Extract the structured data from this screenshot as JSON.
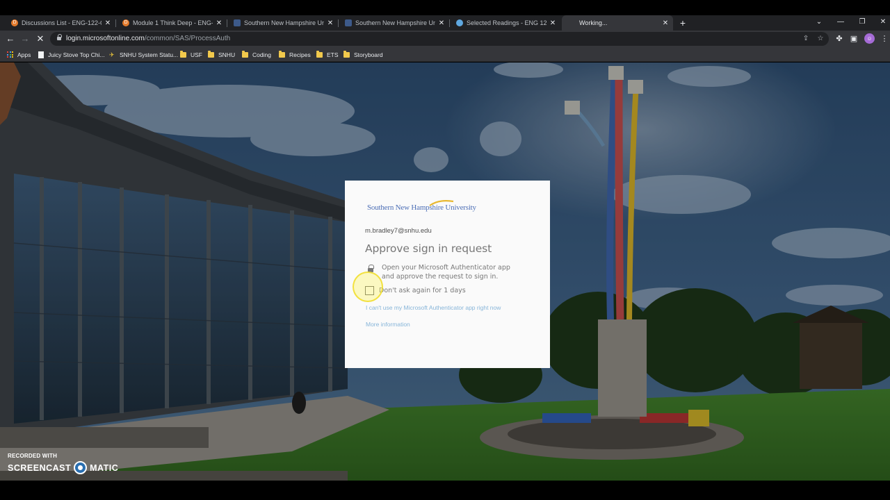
{
  "browser": {
    "tabs": [
      {
        "label": "Discussions List - ENG-122-Q3316",
        "favicon": "d2l-icon",
        "active": false
      },
      {
        "label": "Module 1 Think Deep - ENG-122-Q3",
        "favicon": "d2l-icon",
        "active": false
      },
      {
        "label": "Southern New Hampshire University",
        "favicon": "snhu-page-icon",
        "active": false
      },
      {
        "label": "Southern New Hampshire University",
        "favicon": "snhu-page-icon",
        "active": false
      },
      {
        "label": "Selected Readings - ENG 122 - Co",
        "favicon": "cloud-icon",
        "active": false
      },
      {
        "label": "Working...",
        "favicon": "",
        "active": true
      }
    ],
    "url_host": "login.microsoftonline.com",
    "url_path": "/common/SAS/ProcessAuth",
    "bookmarks": [
      {
        "label": "Apps",
        "icon": "apps-grid-icon"
      },
      {
        "label": "Juicy Stove Top Chi...",
        "icon": "page-icon"
      },
      {
        "label": "SNHU System Statu...",
        "icon": "snhu-icon"
      },
      {
        "label": "USF",
        "icon": "folder-icon"
      },
      {
        "label": "SNHU",
        "icon": "folder-icon"
      },
      {
        "label": "Coding",
        "icon": "folder-icon"
      },
      {
        "label": "Recipes",
        "icon": "folder-icon"
      },
      {
        "label": "ETS",
        "icon": "folder-icon"
      },
      {
        "label": "Storyboard",
        "icon": "folder-icon"
      }
    ],
    "colors": {
      "chrome_dark": "#202124",
      "chrome_toolbar": "#35363a",
      "folder": "#f2c94c"
    }
  },
  "signin": {
    "logo_text": "Southern New Hampshire University",
    "email": "m.bradley7@snhu.edu",
    "title": "Approve sign in request",
    "instruction": "Open your Microsoft Authenticator app and approve the request to sign in.",
    "dont_ask": "Don't ask again for 1 days",
    "dont_ask_checked": false,
    "link_cant_use": "I can't use my Microsoft Authenticator app right now",
    "link_more_info": "More information",
    "colors": {
      "link": "#87b5d9",
      "logo": "#4d6fb6",
      "text": "#777777"
    }
  },
  "watermark": {
    "top": "RECORDED WITH",
    "left": "SCREENCAST",
    "right": "MATIC"
  }
}
